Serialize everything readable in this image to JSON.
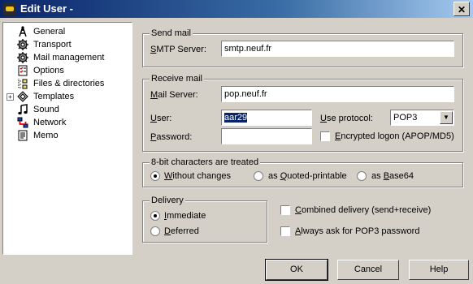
{
  "window": {
    "title": "Edit User -"
  },
  "tree": {
    "items": [
      {
        "label": "General",
        "icon": "antenna-icon"
      },
      {
        "label": "Transport",
        "icon": "gear-icon"
      },
      {
        "label": "Mail management",
        "icon": "gear-icon"
      },
      {
        "label": "Options",
        "icon": "checklist-icon"
      },
      {
        "label": "Files & directories",
        "icon": "folder-tree-icon"
      },
      {
        "label": "Templates",
        "icon": "diamond-icon"
      },
      {
        "label": "Sound",
        "icon": "music-note-icon"
      },
      {
        "label": "Network",
        "icon": "network-icon"
      },
      {
        "label": "Memo",
        "icon": "memo-icon"
      }
    ]
  },
  "send_mail": {
    "title": "Send mail",
    "smtp_label_u": "S",
    "smtp_label_rest": "MTP Server:",
    "smtp_value": "smtp.neuf.fr"
  },
  "receive_mail": {
    "title": "Receive mail",
    "server_label_u": "M",
    "server_label_rest": "ail Server:",
    "server_value": "pop.neuf.fr",
    "user_label_u": "U",
    "user_label_rest": "ser:",
    "user_value": "aar29",
    "protocol_label_u": "U",
    "protocol_label_rest": "se protocol:",
    "protocol_value": "POP3",
    "password_label_u": "P",
    "password_label_rest": "assword:",
    "password_value": "",
    "encrypted_label_u": "E",
    "encrypted_label_rest": "ncrypted logon (APOP/MD5)"
  },
  "eightbit": {
    "title": "8-bit characters are treated",
    "opt1_u": "W",
    "opt1_rest": "ithout changes",
    "opt2_pre": "as ",
    "opt2_u": "Q",
    "opt2_rest": "uoted-printable",
    "opt3_pre": "as ",
    "opt3_u": "B",
    "opt3_rest": "ase64"
  },
  "delivery": {
    "title": "Delivery",
    "opt1_u": "I",
    "opt1_rest": "mmediate",
    "opt2_u": "D",
    "opt2_rest": "eferred",
    "combined_u": "C",
    "combined_rest": "ombined delivery (send+receive)",
    "always_u": "A",
    "always_rest": "lways ask for POP3 password"
  },
  "buttons": {
    "ok": "OK",
    "cancel": "Cancel",
    "help": "Help"
  }
}
